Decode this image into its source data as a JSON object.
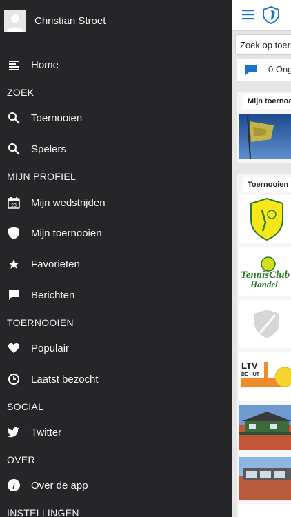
{
  "drawer": {
    "profile_name": "Christian Stroet",
    "items": [
      {
        "label": "Home",
        "icon": "menu-lines-icon"
      },
      {
        "label": "Toernooien",
        "icon": "search-icon"
      },
      {
        "label": "Spelers",
        "icon": "search-icon"
      },
      {
        "label": "Mijn wedstrijden",
        "icon": "calendar-icon",
        "icon_text": "23"
      },
      {
        "label": "Mijn toernooien",
        "icon": "shield-icon"
      },
      {
        "label": "Favorieten",
        "icon": "star-icon"
      },
      {
        "label": "Berichten",
        "icon": "chat-icon"
      },
      {
        "label": "Populair",
        "icon": "heart-icon"
      },
      {
        "label": "Laatst bezocht",
        "icon": "clock-icon"
      },
      {
        "label": "Twitter",
        "icon": "twitter-icon"
      },
      {
        "label": "Over de app",
        "icon": "info-icon"
      }
    ],
    "sections": [
      "ZOEK",
      "MIJN PROFIEL",
      "TOERNOOIEN",
      "SOCIAL",
      "OVER",
      "INSTELLINGEN"
    ]
  },
  "main": {
    "search_text": "Zoek op toerr",
    "messages_text": "0 Ong",
    "card_mijn": "Mijn toernoo",
    "card_toernooien": "Toernooien",
    "logo_text_tennisclub": "TennisClub",
    "logo_text_handel": "Handel",
    "logo_text_ltv": "LTV",
    "logo_text_dehut": "DE HUT"
  },
  "colors": {
    "drawer_bg": "#262629",
    "accent": "#1a73c9",
    "main_bg": "#e6e6e6"
  }
}
